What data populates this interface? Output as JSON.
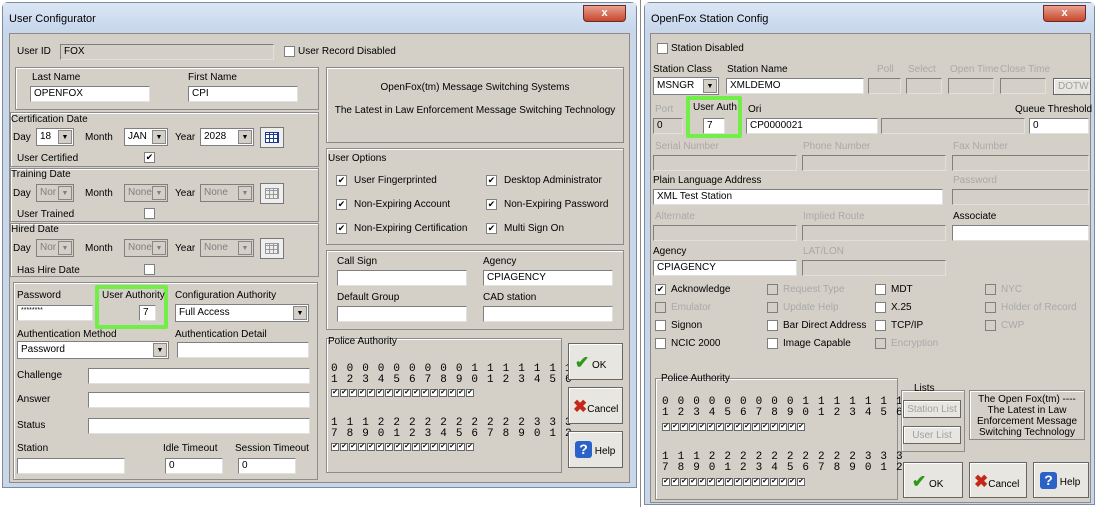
{
  "left": {
    "title": "User Configurator",
    "close": "x",
    "user_id_label": "User ID",
    "user_id": "FOX",
    "record_disabled": "User Record Disabled",
    "last_name_label": "Last Name",
    "last_name": "OPENFOX",
    "first_name_label": "First Name",
    "first_name": "CPI",
    "cert_date": "Certification Date",
    "day": "Day",
    "month": "Month",
    "year": "Year",
    "cert_day": "18",
    "cert_month": "JAN",
    "cert_year": "2028",
    "user_certified": "User Certified",
    "training_date": "Training Date",
    "nor": "Nor",
    "none": "None",
    "user_trained": "User Trained",
    "hired_date": "Hired Date",
    "has_hire_date": "Has Hire Date",
    "password_label": "Password",
    "password": "********",
    "user_authority_label": "User Authority",
    "user_authority": "7",
    "config_authority_label": "Configuration Authority",
    "config_authority": "Full Access",
    "auth_method_label": "Authentication Method",
    "auth_method": "Password",
    "auth_detail_label": "Authentication Detail",
    "challenge": "Challenge",
    "answer": "Answer",
    "status": "Status",
    "station": "Station",
    "idle_timeout": "Idle Timeout",
    "idle_value": "0",
    "session_timeout": "Session Timeout",
    "session_value": "0",
    "info_line1": "OpenFox(tm) Message Switching Systems",
    "info_line2": "The Latest in Law Enforcement Message Switching Technology",
    "user_options": "User Options",
    "opt_fingerprinted": "User Fingerprinted",
    "opt_desktop_admin": "Desktop Administrator",
    "opt_nonexp_account": "Non-Expiring Account",
    "opt_nonexp_password": "Non-Expiring Password",
    "opt_nonexp_cert": "Non-Expiring Certification",
    "opt_multi_signon": "Multi Sign On",
    "call_sign": "Call Sign",
    "agency_label": "Agency",
    "agency": "CPIAGENCY",
    "default_group": "Default Group",
    "cad_station": "CAD station",
    "police_authority": "Police Authority",
    "pa_row1": "0 0 0 0 0 0 0 0 0 1 1 1 1 1 1 1",
    "pa_row2": "1 2 3 4 5 6 7 8 9 0 1 2 3 4 5 6",
    "pa_row3": "1 1 1 2 2 2 2 2 2 2 2 2 2 3 3 3",
    "pa_row4": "7 8 9 0 1 2 3 4 5 6 7 8 9 0 1 2",
    "ok": "OK",
    "cancel": "Cancel",
    "help": "Help"
  },
  "right": {
    "title": "OpenFox Station Config",
    "close": "x",
    "station_disabled": "Station Disabled",
    "station_class_label": "Station Class",
    "station_class": "MSNGR",
    "station_name_label": "Station Name",
    "station_name": "XMLDEMO",
    "poll": "Poll",
    "select": "Select",
    "open_time": "Open Time",
    "close_time": "Close Time",
    "dotw": "DOTW",
    "port_label": "Port",
    "port": "0",
    "user_auth_label": "User Auth",
    "user_auth": "7",
    "ori_label": "Ori",
    "ori": "CP0000021",
    "queue_threshold_label": "Queue Threshold",
    "queue_threshold": "0",
    "serial_number": "Serial Number",
    "phone_number": "Phone Number",
    "fax_number": "Fax Number",
    "pla_label": "Plain Language Address",
    "pla": "XML Test Station",
    "password": "Password",
    "alternate": "Alternate",
    "implied_route": "Implied Route",
    "associate": "Associate",
    "agency_label": "Agency",
    "agency": "CPIAGENCY",
    "latlon": "LAT/LON",
    "acknowledge": "Acknowledge",
    "request_type": "Request Type",
    "mdt": "MDT",
    "nyc": "NYC",
    "emulator": "Emulator",
    "update_help": "Update Help",
    "x25": "X.25",
    "holder_of_record": "Holder of Record",
    "signon": "Signon",
    "bar_direct": "Bar Direct Address",
    "tcpip": "TCP/IP",
    "cwp": "CWP",
    "ncic2000": "NCIC 2000",
    "image_capable": "Image Capable",
    "encryption": "Encryption",
    "police_authority": "Police Authority",
    "lists": "Lists",
    "station_list": "Station List",
    "user_list": "User List",
    "info": "The Open Fox(tm) ---- The Latest in Law Enforcement Message Switching Technology",
    "pa_row1": "0 0 0 0 0 0 0 0 0 1 1 1 1 1 1 1",
    "pa_row2": "1 2 3 4 5 6 7 8 9 0 1 2 3 4 5 6",
    "pa_row3": "1 1 1 2 2 2 2 2 2 2 2 2 2 3 3 3",
    "pa_row4": "7 8 9 0 1 2 3 4 5 6 7 8 9 0 1 2",
    "ok": "OK",
    "cancel": "Cancel",
    "help": "Help"
  },
  "colors": {
    "highlight": "#71ee48",
    "close": "#c5462d"
  }
}
